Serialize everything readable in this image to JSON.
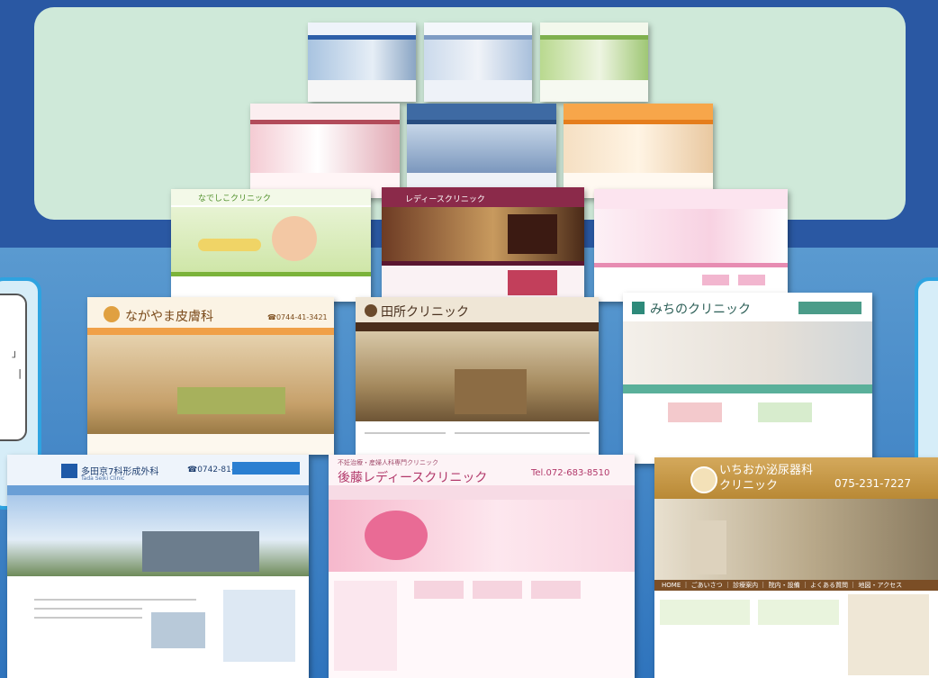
{
  "clinic_sites": {
    "nagoya": {
      "logo": "ながやま皮膚科",
      "phone": "☎0744-41-3421"
    },
    "tanaka": {
      "logo": "田所クリニック"
    },
    "michino": {
      "logo": "みちのクリニック"
    },
    "tada": {
      "logo": "多田京7科形成外科",
      "logo_en": "Tada Seiki Clinic",
      "phone": "☎0742-81-3185"
    },
    "goto": {
      "top_line": "不妊治療・産婦人科専門クリニック",
      "logo": "後藤レディースクリニック",
      "phone": "Tel.072-683-8510"
    },
    "ichioka": {
      "logo": "いちおか泌尿器科\nクリニック",
      "phone": "075-231-7227",
      "nav": "HOME ｜ ごあいさつ ｜ 診療案内 ｜ 院内・設備 ｜ よくある質問 ｜ 地図・アクセス"
    },
    "izumi": {
      "logo": "なでしこクリニック"
    },
    "shin": {
      "logo": "レディースクリニック"
    }
  }
}
